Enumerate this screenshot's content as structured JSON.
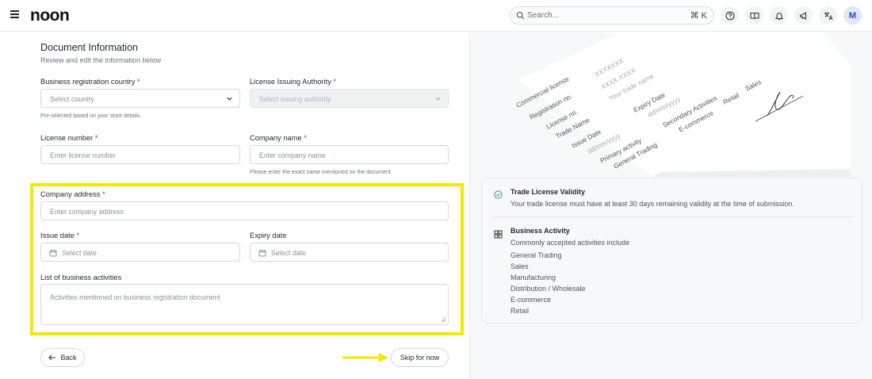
{
  "header": {
    "logo": "noon",
    "search_placeholder": "Search...",
    "search_shortcut": "⌘ K",
    "avatar_initial": "M"
  },
  "form": {
    "title": "Document Information",
    "subtitle": "Review and edit the information below",
    "business_country": {
      "label": "Business registration country",
      "required": "*",
      "placeholder": "Select country",
      "help": "Pre-selected based on your store details."
    },
    "issuing_authority": {
      "label": "License Issuing Authority",
      "required": "*",
      "placeholder": "Select issuing authority"
    },
    "license_number": {
      "label": "License number",
      "required": "*",
      "placeholder": "Enter license number"
    },
    "company_name": {
      "label": "Company name",
      "required": "*",
      "placeholder": "Enter company name",
      "help": "Please enter the exact name mentioned on the document."
    },
    "company_address": {
      "label": "Company address",
      "required": "*",
      "placeholder": "Enter company address"
    },
    "issue_date": {
      "label": "Issue date",
      "required": "*",
      "placeholder": "Select date"
    },
    "expiry_date": {
      "label": "Expiry date",
      "placeholder": "Select date"
    },
    "activities": {
      "label": "List of business activities",
      "placeholder": "Activities mentioned on business registration document"
    },
    "back_label": "Back",
    "skip_label": "Skip for now"
  },
  "colors": {
    "highlight": "#f5e800",
    "accent": "#22a06b"
  },
  "illustration": {
    "rows": [
      "Commercial license",
      "Registration no.",
      "License no.",
      "Trade Name",
      "Issue Date",
      "dd/mm/yyyy",
      "Primary activity",
      "General Trading",
      "XXXXXXX",
      "XXXX XXXX",
      "Your trade name",
      "Expiry Date",
      "dd/mm/yyyy",
      "Secondary Activities",
      "E-commerce",
      "Retail",
      "Sales"
    ]
  },
  "info": {
    "validity": {
      "title": "Trade License Validity",
      "desc": "Your trade license must have at least 30 days remaining validity at the time of submission."
    },
    "activity": {
      "title": "Business Activity",
      "desc": "Commonly accepted activities include",
      "items": [
        "General Trading",
        "Sales",
        "Manufacturing",
        "Distribution / Wholesale",
        "E-commerce",
        "Retail"
      ]
    }
  }
}
